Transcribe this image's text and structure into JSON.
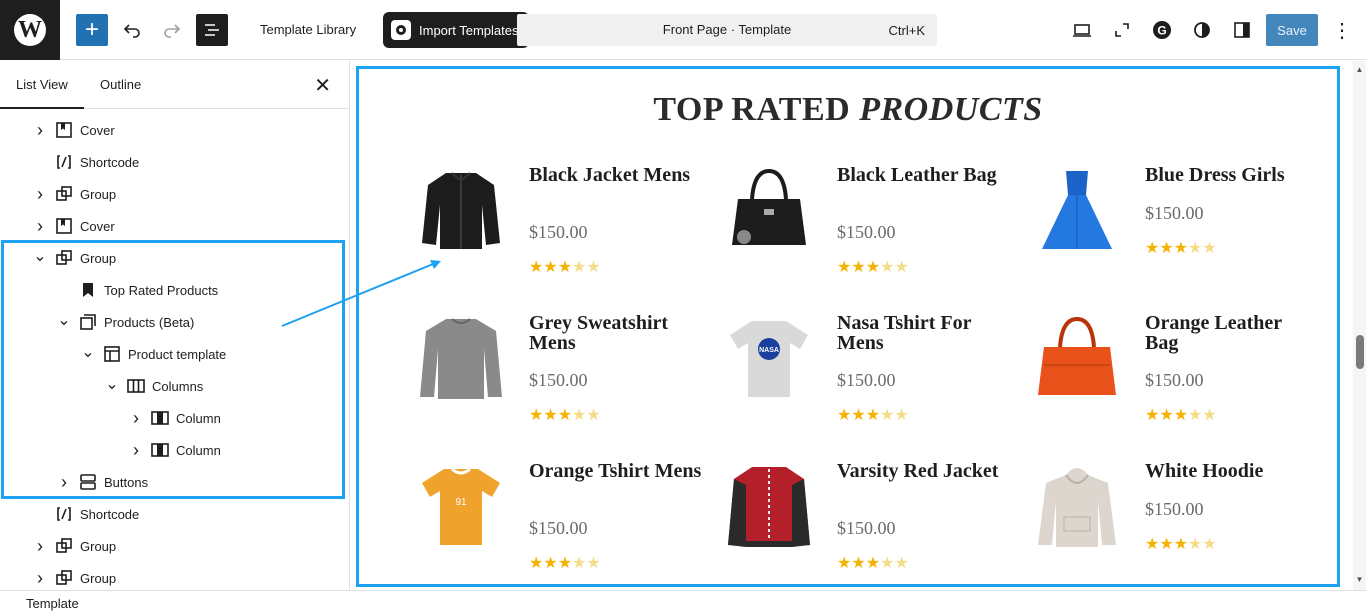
{
  "topbar": {
    "template_library": "Template Library",
    "import_templates": "Import Templates",
    "command_title": "Front Page · Template",
    "command_shortcut": "Ctrl+K",
    "save": "Save"
  },
  "sidebar": {
    "tabs": [
      "List View",
      "Outline"
    ],
    "items": [
      {
        "label": "Cover",
        "icon": "cover-icon",
        "expanded": false
      },
      {
        "label": "Shortcode",
        "icon": "shortcode-icon"
      },
      {
        "label": "Group",
        "icon": "group-icon",
        "expanded": false
      },
      {
        "label": "Cover",
        "icon": "cover-icon",
        "expanded": false
      },
      {
        "label": "Group",
        "icon": "group-icon",
        "expanded": true
      },
      {
        "label": "Top Rated Products",
        "icon": "bookmark-icon"
      },
      {
        "label": "Products (Beta)",
        "icon": "query-loop-icon",
        "expanded": true
      },
      {
        "label": "Product template",
        "icon": "layout-icon",
        "expanded": true
      },
      {
        "label": "Columns",
        "icon": "columns-icon",
        "expanded": true
      },
      {
        "label": "Column",
        "icon": "column-icon",
        "expanded": false
      },
      {
        "label": "Column",
        "icon": "column-icon",
        "expanded": false
      },
      {
        "label": "Buttons",
        "icon": "buttons-icon",
        "expanded": false
      },
      {
        "label": "Shortcode",
        "icon": "shortcode-icon"
      },
      {
        "label": "Group",
        "icon": "group-icon",
        "expanded": false
      },
      {
        "label": "Group",
        "icon": "group-icon",
        "expanded": false
      }
    ]
  },
  "canvas": {
    "heading_normal": "TOP RATED ",
    "heading_italic": "PRODUCTS",
    "products": [
      {
        "name": "Black Jacket Mens",
        "price": "$150.00",
        "rating": 3,
        "image": "black-jacket"
      },
      {
        "name": "Black Leather Bag",
        "price": "$150.00",
        "rating": 3,
        "image": "black-bag"
      },
      {
        "name": "Blue Dress Girls",
        "price": "$150.00",
        "rating": 3,
        "image": "blue-dress"
      },
      {
        "name": "Grey Sweatshirt Mens",
        "price": "$150.00",
        "rating": 3,
        "image": "grey-sweatshirt"
      },
      {
        "name": "Nasa Tshirt For Mens",
        "price": "$150.00",
        "rating": 3,
        "image": "nasa-tshirt"
      },
      {
        "name": "Orange Leather Bag",
        "price": "$150.00",
        "rating": 3,
        "image": "orange-bag"
      },
      {
        "name": "Orange Tshirt Mens",
        "price": "$150.00",
        "rating": 3,
        "image": "orange-tshirt"
      },
      {
        "name": "Varsity Red Jacket",
        "price": "$150.00",
        "rating": 3,
        "image": "varsity-jacket"
      },
      {
        "name": "White Hoodie",
        "price": "$150.00",
        "rating": 3,
        "image": "white-hoodie"
      }
    ]
  },
  "footer": {
    "breadcrumb": "Template"
  },
  "colors": {
    "accent": "#2271b1",
    "highlight": "#1da1f2",
    "star": "#f5b301"
  }
}
